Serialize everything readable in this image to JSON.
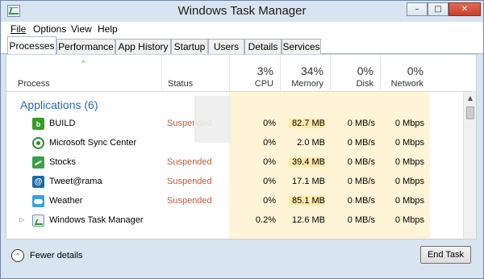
{
  "window": {
    "title": "Windows Task Manager"
  },
  "menu": [
    "File",
    "Options",
    "View",
    "Help"
  ],
  "tabs": [
    "Processes",
    "Performance",
    "App History",
    "Startup",
    "Users",
    "Details",
    "Services"
  ],
  "active_tab": "Processes",
  "columns": {
    "process": "Process",
    "status": "Status",
    "cpu": {
      "percent": "3%",
      "label": "CPU"
    },
    "memory": {
      "percent": "34%",
      "label": "Memory"
    },
    "disk": {
      "percent": "0%",
      "label": "Disk"
    },
    "network": {
      "percent": "0%",
      "label": "Network"
    }
  },
  "group": {
    "label": "Applications (6)"
  },
  "rows": [
    {
      "name": "BUILD",
      "status": "Suspended",
      "cpu": "0%",
      "memory": "82.7 MB",
      "disk": "0 MB/s",
      "network": "0 Mbps",
      "icon": "build-icon",
      "icon_text": "b"
    },
    {
      "name": "Microsoft Sync Center",
      "status": "",
      "cpu": "0%",
      "memory": "2.0 MB",
      "disk": "0 MB/s",
      "network": "0 Mbps",
      "icon": "sync-center-icon",
      "icon_text": ""
    },
    {
      "name": "Stocks",
      "status": "Suspended",
      "cpu": "0%",
      "memory": "39.4 MB",
      "disk": "0 MB/s",
      "network": "0 Mbps",
      "icon": "stocks-icon",
      "icon_text": ""
    },
    {
      "name": "Tweet@rama",
      "status": "Suspended",
      "cpu": "0%",
      "memory": "17.1 MB",
      "disk": "0 MB/s",
      "network": "0 Mbps",
      "icon": "tweetrama-icon",
      "icon_text": "@"
    },
    {
      "name": "Weather",
      "status": "Suspended",
      "cpu": "0%",
      "memory": "85.1 MB",
      "disk": "0 MB/s",
      "network": "0 Mbps",
      "icon": "weather-icon",
      "icon_text": ""
    },
    {
      "name": "Windows Task Manager",
      "status": "",
      "cpu": "0.2%",
      "memory": "12.6 MB",
      "disk": "0 MB/s",
      "network": "0 Mbps",
      "icon": "task-manager-icon",
      "icon_text": ""
    }
  ],
  "footer": {
    "fewer_details": "Fewer details",
    "end_task": "End Task"
  },
  "colors": {
    "accent": "#2a6aac",
    "suspended": "#b85c3c",
    "heat_light": "#fff4d6",
    "heat_medium": "#ffe9a8"
  }
}
